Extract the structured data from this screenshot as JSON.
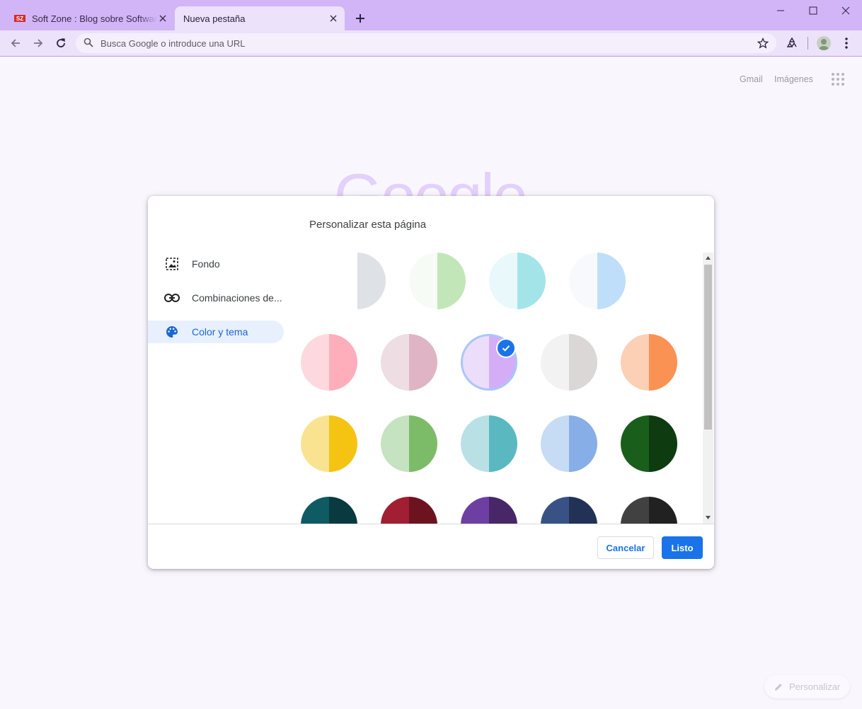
{
  "browser": {
    "tabs": [
      {
        "title": "Soft Zone : Blog sobre Software c",
        "favicon": "softzone-favicon",
        "active": false
      },
      {
        "title": "Nueva pestaña",
        "favicon": "",
        "active": true
      }
    ],
    "new_tab_icon": "plus-icon",
    "window_controls": [
      "minimize-icon",
      "maximize-icon",
      "close-icon"
    ],
    "omnibox": {
      "placeholder": "Busca Google o introduce una URL"
    },
    "colors": {
      "frame": "#d1b5f6",
      "toolbar": "#ece2fa",
      "page_bg": "#f9f6fd"
    }
  },
  "ntp": {
    "links": [
      "Gmail",
      "Imágenes"
    ],
    "google_logo": "Google",
    "personalize_label": "Personalizar"
  },
  "dialog": {
    "title": "Personalizar esta página",
    "menu": [
      {
        "label": "Fondo",
        "icon": "image-icon",
        "selected": false
      },
      {
        "label": "Combinaciones de...",
        "icon": "link-icon",
        "selected": false
      },
      {
        "label": "Color y tema",
        "icon": "palette-icon",
        "selected": true
      }
    ],
    "themes": [
      [
        {
          "left": null,
          "right": "#dee1e6"
        },
        {
          "left": "#f7fbf6",
          "right": "#c3e6b8"
        },
        {
          "left": "#e9f8fa",
          "right": "#a3e4e9"
        },
        {
          "left": "#f7f9fd",
          "right": "#bedef9"
        }
      ],
      [
        {
          "left": "#fdd9df",
          "right": "#feadbb"
        },
        {
          "left": "#efdde4",
          "right": "#dfb5c5"
        },
        {
          "left": "#ecddfb",
          "right": "#d3aef7",
          "selected": true
        },
        {
          "left": "#f3f2f2",
          "right": "#dad7d6"
        },
        {
          "left": "#fbd0b5",
          "right": "#fa9253"
        }
      ],
      [
        {
          "left": "#f9e391",
          "right": "#f5c312"
        },
        {
          "left": "#c5e2c1",
          "right": "#7cbc68"
        },
        {
          "left": "#b8e0e5",
          "right": "#5ab8c1"
        },
        {
          "left": "#c6dbf4",
          "right": "#87aee6"
        },
        {
          "left": "#1a5e1c",
          "right": "#0e3b10"
        }
      ],
      [
        {
          "left": "#0e5b63",
          "right": "#083a40"
        },
        {
          "left": "#a21e32",
          "right": "#6d1320"
        },
        {
          "left": "#6e3fa3",
          "right": "#472767"
        },
        {
          "left": "#385285",
          "right": "#213256"
        },
        {
          "left": "#414141",
          "right": "#212121"
        }
      ]
    ],
    "buttons": {
      "cancel": "Cancelar",
      "done": "Listo"
    },
    "accent": "#1a73e8"
  }
}
